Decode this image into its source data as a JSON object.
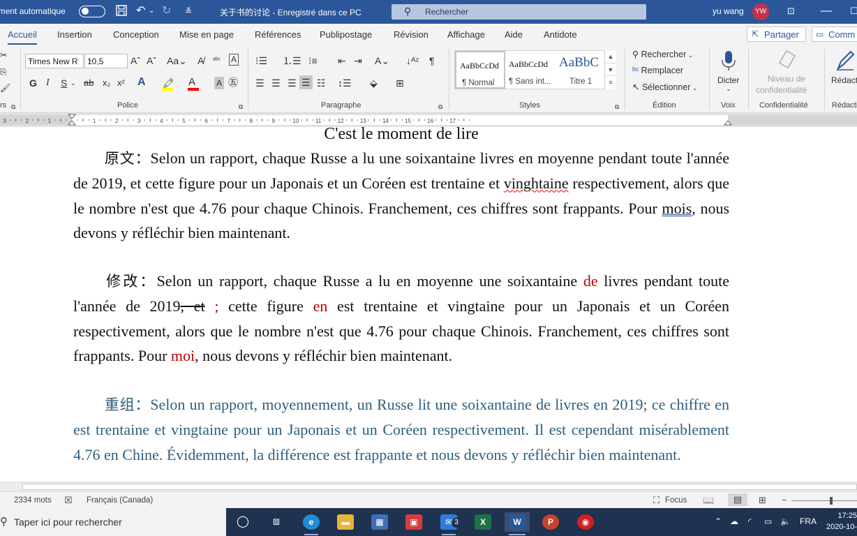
{
  "window": {
    "autosave_label": "Enregistrement automatique",
    "doc_title": "关于书的讨论 - Enregistré dans ce PC",
    "search_label": "Rechercher",
    "user_name": "yu wang",
    "user_initials": "YW",
    "accent_color": "#2b579a"
  },
  "ribbon_tabs": {
    "accueil": "Accueil",
    "insertion": "Insertion",
    "conception": "Conception",
    "mise_en_page": "Mise en page",
    "references": "Références",
    "publipostage": "Publipostage",
    "revision": "Révision",
    "affichage": "Affichage",
    "aide": "Aide",
    "antidote": "Antidote",
    "share": "Partager",
    "comments": "Comm"
  },
  "ribbon": {
    "font_name": "Times New R",
    "font_size": "10,5",
    "group_police": "Police",
    "group_paragraphe": "Paragraphe",
    "group_styles": "Styles",
    "group_edition": "Édition",
    "group_voix": "Voix",
    "group_confidentialite": "Confidentialité",
    "group_redaction": "Rédacti",
    "clipboard_label": "rs",
    "styles": [
      {
        "preview": "AaBbCcDd",
        "name": "¶ Normal"
      },
      {
        "preview": "AaBbCcDd",
        "name": "¶ Sans int..."
      },
      {
        "preview": "AaBbC",
        "name": "Titre 1"
      }
    ],
    "rechercher": "Rechercher",
    "remplacer": "Remplacer",
    "selectionner": "Sélectionner",
    "dicter": "Dicter",
    "niveau_line1": "Niveau de",
    "niveau_line2": "confidentialité",
    "redacteur": "Rédacte"
  },
  "document": {
    "heading": "C'est le moment de lire",
    "p1": {
      "label": "原文：",
      "t1": "Selon un rapport, chaque Russe a lu une soixantaine livres en moyenne pendant toute l'année de 2019, et cette figure pour un Japonais et un Coréen est trentaine et ",
      "spell_word": "vinghtaine",
      "t2": " respectivement, alors que le nombre n'est que 4.76 pour chaque Chinois. Franchement, ces chiffres sont frappants. Pour ",
      "gram_word": "mois",
      "t3": ", nous devons y réfléchir bien maintenant."
    },
    "p2": {
      "label": "修改：",
      "t1": "Selon un rapport, chaque Russe a lu en moyenne une soixantaine ",
      "red1": "de",
      "t2": " livres pendant toute l'année de 2019",
      "struck": ", et",
      "red2": " ;",
      "t3": " cette figure ",
      "red3": "en",
      "t4": " est trentaine et vingtaine pour un Japonais et un Coréen respectivement, alors que le nombre n'est que 4.76 pour chaque Chinois. Franchement, ces chiffres sont frappants. Pour ",
      "red4": "moi",
      "t5": ", nous devons y réfléchir bien maintenant."
    },
    "p3": {
      "label": "重组：",
      "text": "Selon un rapport, moyennement, un Russe lit une soixantaine de livres en 2019; ce chiffre en est trentaine et vingtaine pour un Japonais et un Coréen respectivement. Il est cependant misérablement 4.76 en Chine. Évidemment, la différence est frappante et nous devons y réfléchir bien maintenant."
    }
  },
  "statusbar": {
    "word_count": "2334 mots",
    "language": "Français (Canada)",
    "focus": "Focus"
  },
  "taskbar": {
    "search_placeholder": "Taper ici pour rechercher",
    "mail_badge": "3",
    "language": "FRA",
    "time": "17:25",
    "date": "2020-10-"
  }
}
